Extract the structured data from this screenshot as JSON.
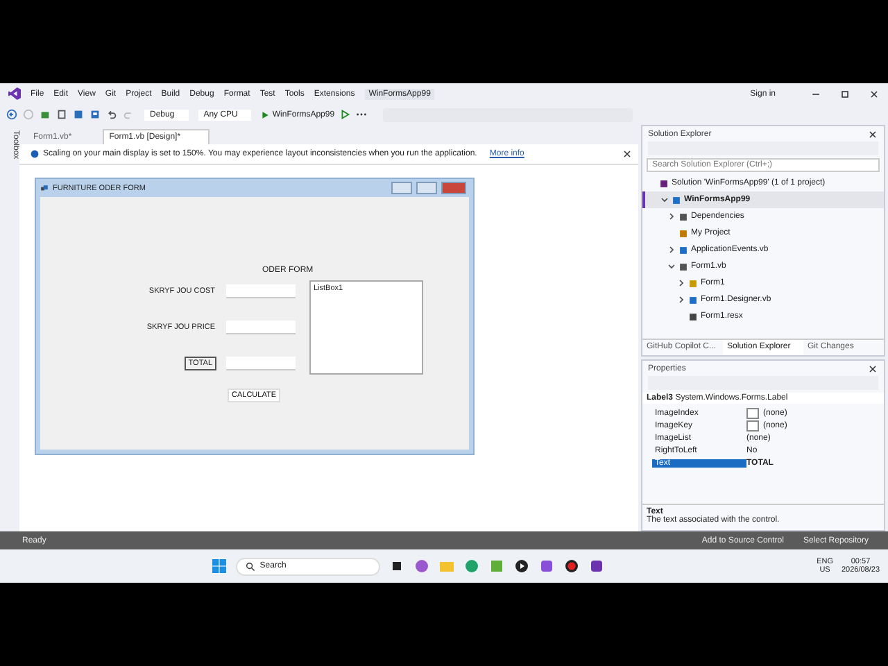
{
  "window": {
    "title": "WinFormsApp99"
  },
  "menu": [
    "File",
    "Edit",
    "View",
    "Git",
    "Project",
    "Build",
    "Debug",
    "Format",
    "Test",
    "Tools",
    "Extensions"
  ],
  "account": {
    "label": "Sign in"
  },
  "toolbar": {
    "configuration": "Debug",
    "platform": "Any CPU",
    "run_target": "WinFormsApp99"
  },
  "toolbox_tab": "Toolbox",
  "doc_tabs": [
    {
      "label": "Form1.vb*",
      "selected": false
    },
    {
      "label": "Form1.vb [Design]*",
      "selected": true
    }
  ],
  "info_bar": {
    "message": "Scaling on your main display is set to 150%. You may experience layout inconsistencies when you run the application.",
    "link": "More info"
  },
  "form": {
    "title": "FURNITURE ODER FORM",
    "heading": "ODER FORM",
    "fields": [
      {
        "label": "SKRYF JOU COST",
        "selected": false
      },
      {
        "label": "SKRYF JOU PRICE",
        "selected": false
      },
      {
        "label": "TOTAL",
        "selected": true
      }
    ],
    "listbox": "ListBox1",
    "button": "CALCULATE"
  },
  "solution_explorer": {
    "title": "Solution Explorer",
    "search_placeholder": "Search Solution Explorer (Ctrl+;)",
    "tree": [
      {
        "label": "Solution 'WinFormsApp99' (1 of 1 project)",
        "kind": "solution",
        "selected": false,
        "children": [
          {
            "label": "WinFormsApp99",
            "kind": "project",
            "selected": true,
            "expanded": true,
            "children": [
              {
                "label": "Dependencies",
                "kind": "dependencies",
                "selected": false,
                "expanded": false
              },
              {
                "label": "My Project",
                "kind": "myproject",
                "selected": false
              },
              {
                "label": "ApplicationEvents.vb",
                "kind": "vb",
                "selected": false,
                "expanded": false
              },
              {
                "label": "Form1.vb",
                "kind": "form",
                "selected": false,
                "expanded": true,
                "children": [
                  {
                    "label": "Form1",
                    "kind": "class",
                    "selected": false,
                    "expanded": false
                  },
                  {
                    "label": "Form1.Designer.vb",
                    "kind": "vb",
                    "selected": false,
                    "expanded": false
                  },
                  {
                    "label": "Form1.resx",
                    "kind": "resx",
                    "selected": false
                  }
                ]
              }
            ]
          }
        ]
      }
    ]
  },
  "bottom_tabs": [
    {
      "label": "GitHub Copilot C...",
      "selected": false
    },
    {
      "label": "Solution Explorer",
      "selected": true
    },
    {
      "label": "Git Changes",
      "selected": false
    }
  ],
  "properties": {
    "title": "Properties",
    "object": "Label3",
    "type": "System.Windows.Forms.Label",
    "rows": [
      {
        "name": "ImageIndex",
        "value": "(none)",
        "kind": "image",
        "selected": false,
        "modified": false
      },
      {
        "name": "ImageKey",
        "value": "(none)",
        "kind": "image",
        "selected": false,
        "modified": false
      },
      {
        "name": "ImageList",
        "value": "(none)",
        "kind": "plain",
        "selected": false,
        "modified": false
      },
      {
        "name": "RightToLeft",
        "value": "No",
        "kind": "plain",
        "selected": false,
        "modified": false
      },
      {
        "name": "Text",
        "value": "TOTAL",
        "kind": "plain",
        "selected": true,
        "modified": true
      }
    ],
    "description_title": "Text",
    "description": "The text associated with the control."
  },
  "status_bar": {
    "status": "Ready",
    "source_control": "Add to Source Control",
    "repository": "Select Repository"
  },
  "taskbar": {
    "search_placeholder": "Search",
    "language": "ENG",
    "region": "US",
    "time": "00:57",
    "date": "2026/08/23"
  }
}
